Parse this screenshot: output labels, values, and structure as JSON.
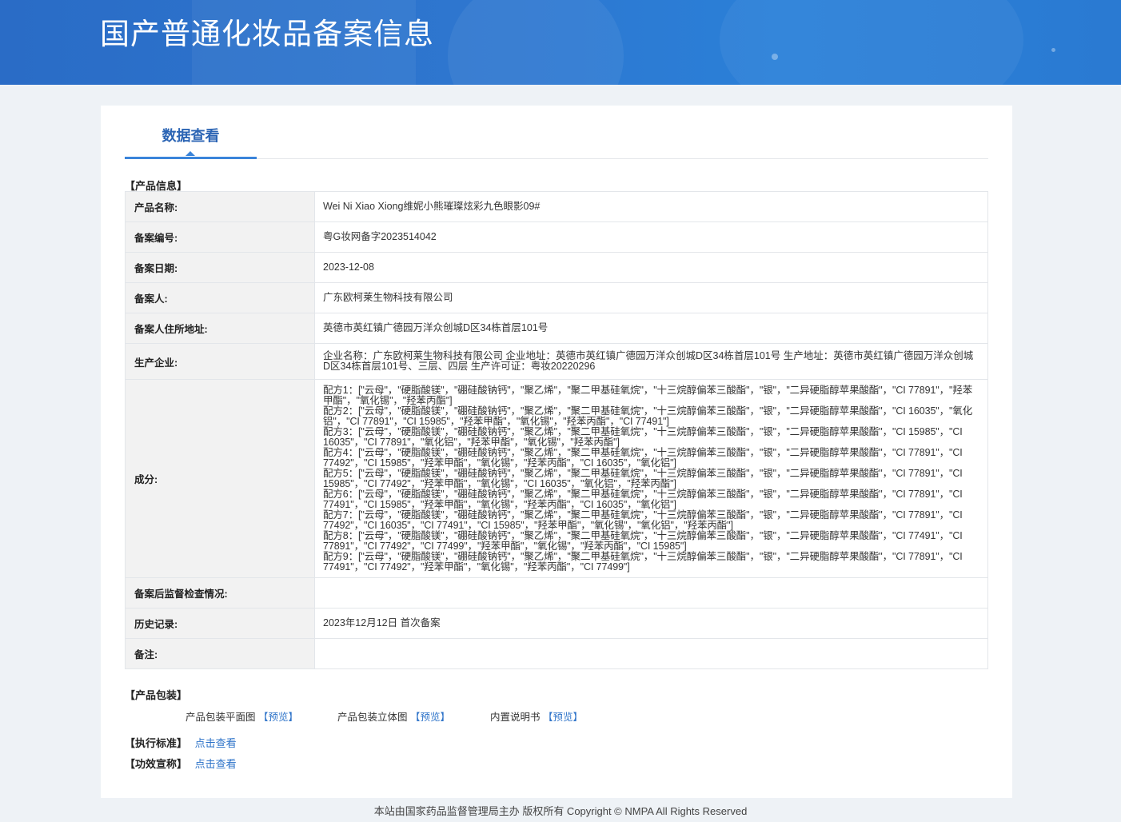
{
  "header": {
    "title": "国产普通化妆品备案信息"
  },
  "tab": {
    "label": "数据查看"
  },
  "sections": {
    "product_info": "【产品信息】",
    "packaging": "【产品包装】",
    "standard": "【执行标准】",
    "efficacy": "【功效宣称】"
  },
  "rows": [
    {
      "label": "产品名称:",
      "value": "Wei Ni Xiao Xiong维妮小熊璀璨炫彩九色眼影09#"
    },
    {
      "label": "备案编号:",
      "value": "粤G妆网备字2023514042"
    },
    {
      "label": "备案日期:",
      "value": "2023-12-08"
    },
    {
      "label": "备案人:",
      "value": "广东欧柯莱生物科技有限公司"
    },
    {
      "label": "备案人住所地址:",
      "value": "英德市英红镇广德园万洋众创城D区34栋首层101号"
    },
    {
      "label": "生产企业:",
      "value": "企业名称：广东欧柯莱生物科技有限公司 企业地址：英德市英红镇广德园万洋众创城D区34栋首层101号 生产地址：英德市英红镇广德园万洋众创城D区34栋首层101号、三层、四层 生产许可证：粤妆20220296"
    },
    {
      "label": "成分:",
      "value": "配方1：[\"云母\"，\"硬脂酸镁\"，\"硼硅酸钠钙\"，\"聚乙烯\"，\"聚二甲基硅氧烷\"，\"十三烷醇偏苯三酸酯\"，\"银\"，\"二异硬脂醇苹果酸酯\"，\"CI 77891\"，\"羟苯甲酯\"，\"氧化锡\"，\"羟苯丙酯\"]\n配方2：[\"云母\"，\"硬脂酸镁\"，\"硼硅酸钠钙\"，\"聚乙烯\"，\"聚二甲基硅氧烷\"，\"十三烷醇偏苯三酸酯\"，\"银\"，\"二异硬脂醇苹果酸酯\"，\"CI 16035\"，\"氧化铝\"，\"CI 77891\"，\"CI 15985\"，\"羟苯甲酯\"，\"氧化锡\"，\"羟苯丙酯\"，\"CI 77491\"]\n配方3：[\"云母\"，\"硬脂酸镁\"，\"硼硅酸钠钙\"，\"聚乙烯\"，\"聚二甲基硅氧烷\"，\"十三烷醇偏苯三酸酯\"，\"银\"，\"二异硬脂醇苹果酸酯\"，\"CI 15985\"，\"CI 16035\"，\"CI 77891\"，\"氧化铝\"，\"羟苯甲酯\"，\"氧化锡\"，\"羟苯丙酯\"]\n配方4：[\"云母\"，\"硬脂酸镁\"，\"硼硅酸钠钙\"，\"聚乙烯\"，\"聚二甲基硅氧烷\"，\"十三烷醇偏苯三酸酯\"，\"银\"，\"二异硬脂醇苹果酸酯\"，\"CI 77891\"，\"CI 77492\"，\"CI 15985\"，\"羟苯甲酯\"，\"氧化锡\"，\"羟苯丙酯\"，\"CI 16035\"，\"氧化铝\"]\n配方5：[\"云母\"，\"硬脂酸镁\"，\"硼硅酸钠钙\"，\"聚乙烯\"，\"聚二甲基硅氧烷\"，\"十三烷醇偏苯三酸酯\"，\"银\"，\"二异硬脂醇苹果酸酯\"，\"CI 77891\"，\"CI 15985\"，\"CI 77492\"，\"羟苯甲酯\"，\"氧化锡\"，\"CI 16035\"，\"氧化铝\"，\"羟苯丙酯\"]\n配方6：[\"云母\"，\"硬脂酸镁\"，\"硼硅酸钠钙\"，\"聚乙烯\"，\"聚二甲基硅氧烷\"，\"十三烷醇偏苯三酸酯\"，\"银\"，\"二异硬脂醇苹果酸酯\"，\"CI 77891\"，\"CI 77491\"，\"CI 15985\"，\"羟苯甲酯\"，\"氧化锡\"，\"羟苯丙酯\"，\"CI 16035\"，\"氧化铝\"]\n配方7：[\"云母\"，\"硬脂酸镁\"，\"硼硅酸钠钙\"，\"聚乙烯\"，\"聚二甲基硅氧烷\"，\"十三烷醇偏苯三酸酯\"，\"银\"，\"二异硬脂醇苹果酸酯\"，\"CI 77891\"，\"CI 77492\"，\"CI 16035\"，\"CI 77491\"，\"CI 15985\"，\"羟苯甲酯\"，\"氧化锡\"，\"氧化铝\"，\"羟苯丙酯\"]\n配方8：[\"云母\"，\"硬脂酸镁\"，\"硼硅酸钠钙\"，\"聚乙烯\"，\"聚二甲基硅氧烷\"，\"十三烷醇偏苯三酸酯\"，\"银\"，\"二异硬脂醇苹果酸酯\"，\"CI 77491\"，\"CI 77891\"，\"CI 77492\"，\"CI 77499\"，\"羟苯甲酯\"，\"氧化锡\"，\"羟苯丙酯\"，\"CI 15985\"]\n配方9：[\"云母\"，\"硬脂酸镁\"，\"硼硅酸钠钙\"，\"聚乙烯\"，\"聚二甲基硅氧烷\"，\"十三烷醇偏苯三酸酯\"，\"银\"，\"二异硬脂醇苹果酸酯\"，\"CI 77891\"，\"CI 77491\"，\"CI 77492\"，\"羟苯甲酯\"，\"氧化锡\"，\"羟苯丙酯\"，\"CI 77499\"]"
    },
    {
      "label": "备案后监督检查情况:",
      "value": ""
    },
    {
      "label": "历史记录:",
      "value": "2023年12月12日 首次备案"
    },
    {
      "label": "备注:",
      "value": ""
    }
  ],
  "packaging": {
    "flat": {
      "label": "产品包装平面图",
      "link": "【预览】"
    },
    "stereo": {
      "label": "产品包装立体图",
      "link": "【预览】"
    },
    "manual": {
      "label": "内置说明书",
      "link": "【预览】"
    }
  },
  "links": {
    "view": "点击查看"
  },
  "footer": {
    "text": "本站由国家药品监督管理局主办 版权所有 Copyright © NMPA All Rights Reserved"
  }
}
